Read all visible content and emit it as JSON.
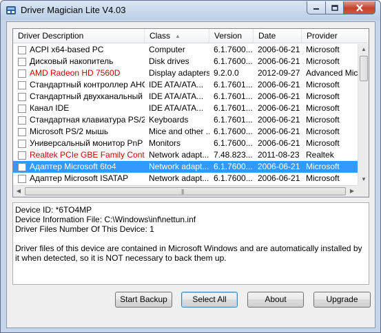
{
  "window": {
    "title": "Driver Magician Lite V4.03",
    "close_color": "#c5412b",
    "selection_color": "#3399ff"
  },
  "list": {
    "columns": [
      "Driver Description",
      "Class",
      "Version",
      "Date",
      "Provider"
    ],
    "sorted_column": "Class",
    "rows": [
      {
        "description": "ACPI x64-based PC",
        "class": "Computer",
        "version": "6.1.7600...",
        "date": "2006-06-21",
        "provider": "Microsoft",
        "highlight": false,
        "selected": false
      },
      {
        "description": "Дисковый накопитель",
        "class": "Disk drives",
        "version": "6.1.7600...",
        "date": "2006-06-21",
        "provider": "Microsoft",
        "highlight": false,
        "selected": false
      },
      {
        "description": "AMD Radeon HD 7560D",
        "class": "Display adapters",
        "version": "9.2.0.0",
        "date": "2012-09-27",
        "provider": "Advanced Micro",
        "highlight": true,
        "selected": false
      },
      {
        "description": "Стандартный контроллер AHCI...",
        "class": "IDE ATA/ATA...",
        "version": "6.1.7601...",
        "date": "2006-06-21",
        "provider": "Microsoft",
        "highlight": false,
        "selected": false
      },
      {
        "description": "Стандартный двухканальный к...",
        "class": "IDE ATA/ATA...",
        "version": "6.1.7601...",
        "date": "2006-06-21",
        "provider": "Microsoft",
        "highlight": false,
        "selected": false
      },
      {
        "description": "Канал IDE",
        "class": "IDE ATA/ATA...",
        "version": "6.1.7601...",
        "date": "2006-06-21",
        "provider": "Microsoft",
        "highlight": false,
        "selected": false
      },
      {
        "description": "Стандартная клавиатура PS/2",
        "class": "Keyboards",
        "version": "6.1.7601...",
        "date": "2006-06-21",
        "provider": "Microsoft",
        "highlight": false,
        "selected": false
      },
      {
        "description": "Microsoft PS/2 мышь",
        "class": "Mice and other ...",
        "version": "6.1.7600...",
        "date": "2006-06-21",
        "provider": "Microsoft",
        "highlight": false,
        "selected": false
      },
      {
        "description": "Универсальный монитор PnP",
        "class": "Monitors",
        "version": "6.1.7600...",
        "date": "2006-06-21",
        "provider": "Microsoft",
        "highlight": false,
        "selected": false
      },
      {
        "description": "Realtek PCIe GBE Family Controller",
        "class": "Network adapt...",
        "version": "7.48.823...",
        "date": "2011-08-23",
        "provider": "Realtek",
        "highlight": true,
        "selected": false
      },
      {
        "description": "Адаптер Microsoft 6to4",
        "class": "Network adapt...",
        "version": "6.1.7600...",
        "date": "2006-06-21",
        "provider": "Microsoft",
        "highlight": false,
        "selected": true
      },
      {
        "description": "Адаптер Microsoft ISATAP",
        "class": "Network adapt...",
        "version": "6.1.7600...",
        "date": "2006-06-21",
        "provider": "Microsoft",
        "highlight": false,
        "selected": false
      }
    ]
  },
  "info": {
    "device_id": "Device ID: *6TO4MP",
    "info_file": "Device Information File: C:\\Windows\\inf\\nettun.inf",
    "files_count": "Driver Files Number Of This Device: 1",
    "message": "Driver files of this device are contained in Microsoft Windows and are automatically installed by it when detected, so it is NOT necessary to back them up."
  },
  "buttons": {
    "start_backup": "Start Backup",
    "select_all": "Select All",
    "about": "About",
    "upgrade": "Upgrade"
  }
}
